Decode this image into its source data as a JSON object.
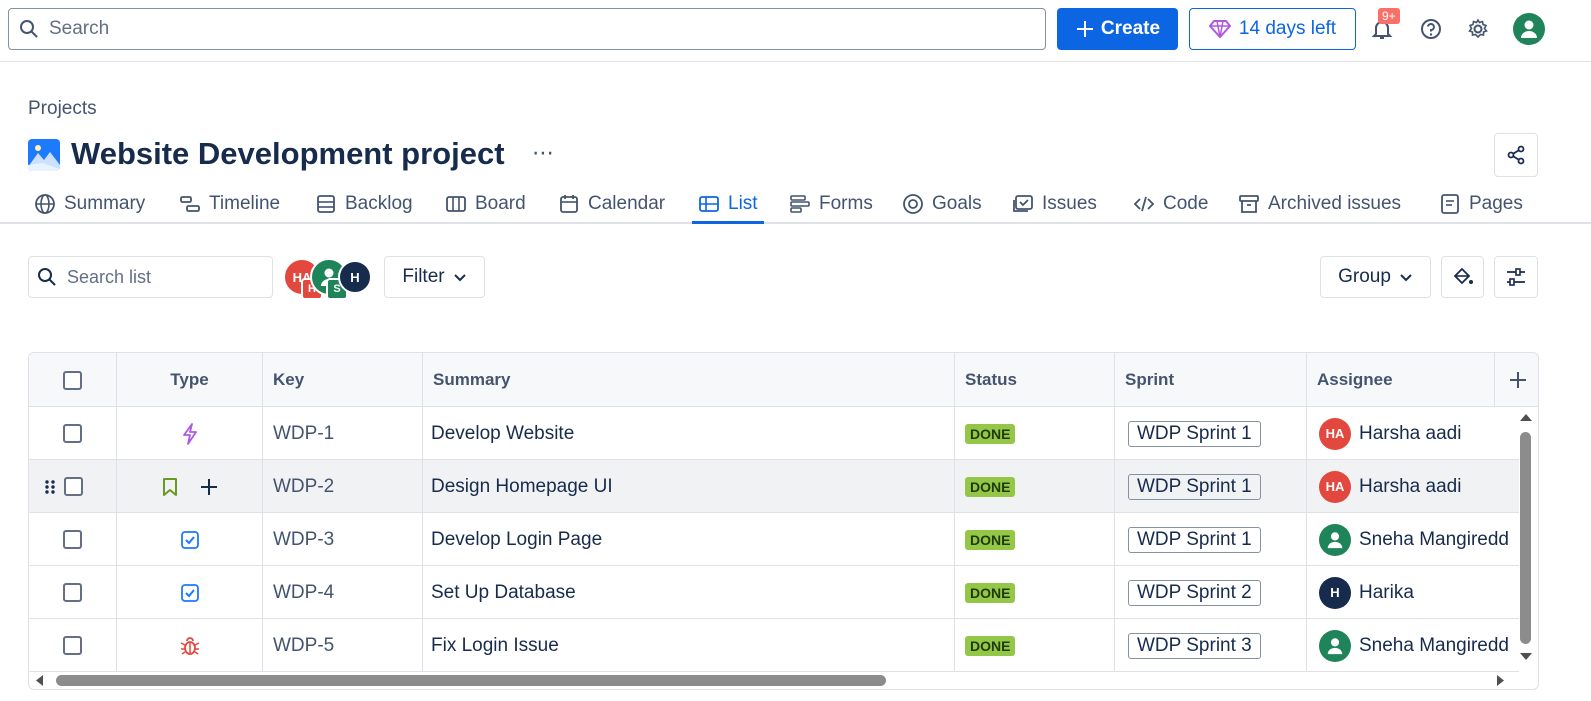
{
  "topbar": {
    "search_placeholder": "Search",
    "create_label": "Create",
    "trial_label": "14 days left",
    "notifications_badge": "9+"
  },
  "header": {
    "breadcrumb": "Projects",
    "title": "Website Development project",
    "more_label": "⋯"
  },
  "tabs": [
    {
      "label": "Summary",
      "icon": "globe-icon"
    },
    {
      "label": "Timeline",
      "icon": "timeline-icon"
    },
    {
      "label": "Backlog",
      "icon": "backlog-icon"
    },
    {
      "label": "Board",
      "icon": "board-icon"
    },
    {
      "label": "Calendar",
      "icon": "calendar-icon"
    },
    {
      "label": "List",
      "icon": "list-icon",
      "active": true
    },
    {
      "label": "Forms",
      "icon": "forms-icon"
    },
    {
      "label": "Goals",
      "icon": "goals-icon"
    },
    {
      "label": "Issues",
      "icon": "issues-icon"
    },
    {
      "label": "Code",
      "icon": "code-icon"
    },
    {
      "label": "Archived issues",
      "icon": "archive-icon"
    },
    {
      "label": "Pages",
      "icon": "pages-icon"
    }
  ],
  "toolbar": {
    "search_placeholder": "Search list",
    "filter_label": "Filter",
    "group_label": "Group",
    "avatars": [
      {
        "initials": "HA",
        "color": "#e2483d"
      },
      {
        "initials": "H",
        "color": "#e2483d"
      },
      {
        "initials": "S",
        "color": "#1f845a"
      },
      {
        "initials": "H",
        "color": "#172b4d"
      }
    ]
  },
  "table": {
    "columns": [
      "Type",
      "Key",
      "Summary",
      "Status",
      "Sprint",
      "Assignee"
    ],
    "rows": [
      {
        "type": "epic-icon",
        "key": "WDP-1",
        "summary": "Develop Website",
        "status": "DONE",
        "sprint": "WDP Sprint 1",
        "assignee": "Harsha aadi",
        "assignee_initials": "HA",
        "assignee_color": "#e2483d"
      },
      {
        "type": "story-icon",
        "key": "WDP-2",
        "summary": "Design Homepage UI",
        "status": "DONE",
        "sprint": "WDP Sprint 1",
        "assignee": "Harsha aadi",
        "assignee_initials": "HA",
        "assignee_color": "#e2483d"
      },
      {
        "type": "task-icon",
        "key": "WDP-3",
        "summary": "Develop Login Page",
        "status": "DONE",
        "sprint": "WDP Sprint 1",
        "assignee": "Sneha Mangiredd",
        "assignee_initials": "",
        "assignee_color": "#1f845a"
      },
      {
        "type": "task-icon",
        "key": "WDP-4",
        "summary": "Set Up Database",
        "status": "DONE",
        "sprint": "WDP Sprint 2",
        "assignee": "Harika",
        "assignee_initials": "H",
        "assignee_color": "#172b4d"
      },
      {
        "type": "bug-icon",
        "key": "WDP-5",
        "summary": "Fix Login Issue",
        "status": "DONE",
        "sprint": "WDP Sprint 3",
        "assignee": "Sneha Mangiredd",
        "assignee_initials": "",
        "assignee_color": "#1f845a"
      }
    ]
  },
  "colors": {
    "primary": "#0c66e4",
    "done": "#94c748",
    "trial_icon": "#af59e1"
  }
}
